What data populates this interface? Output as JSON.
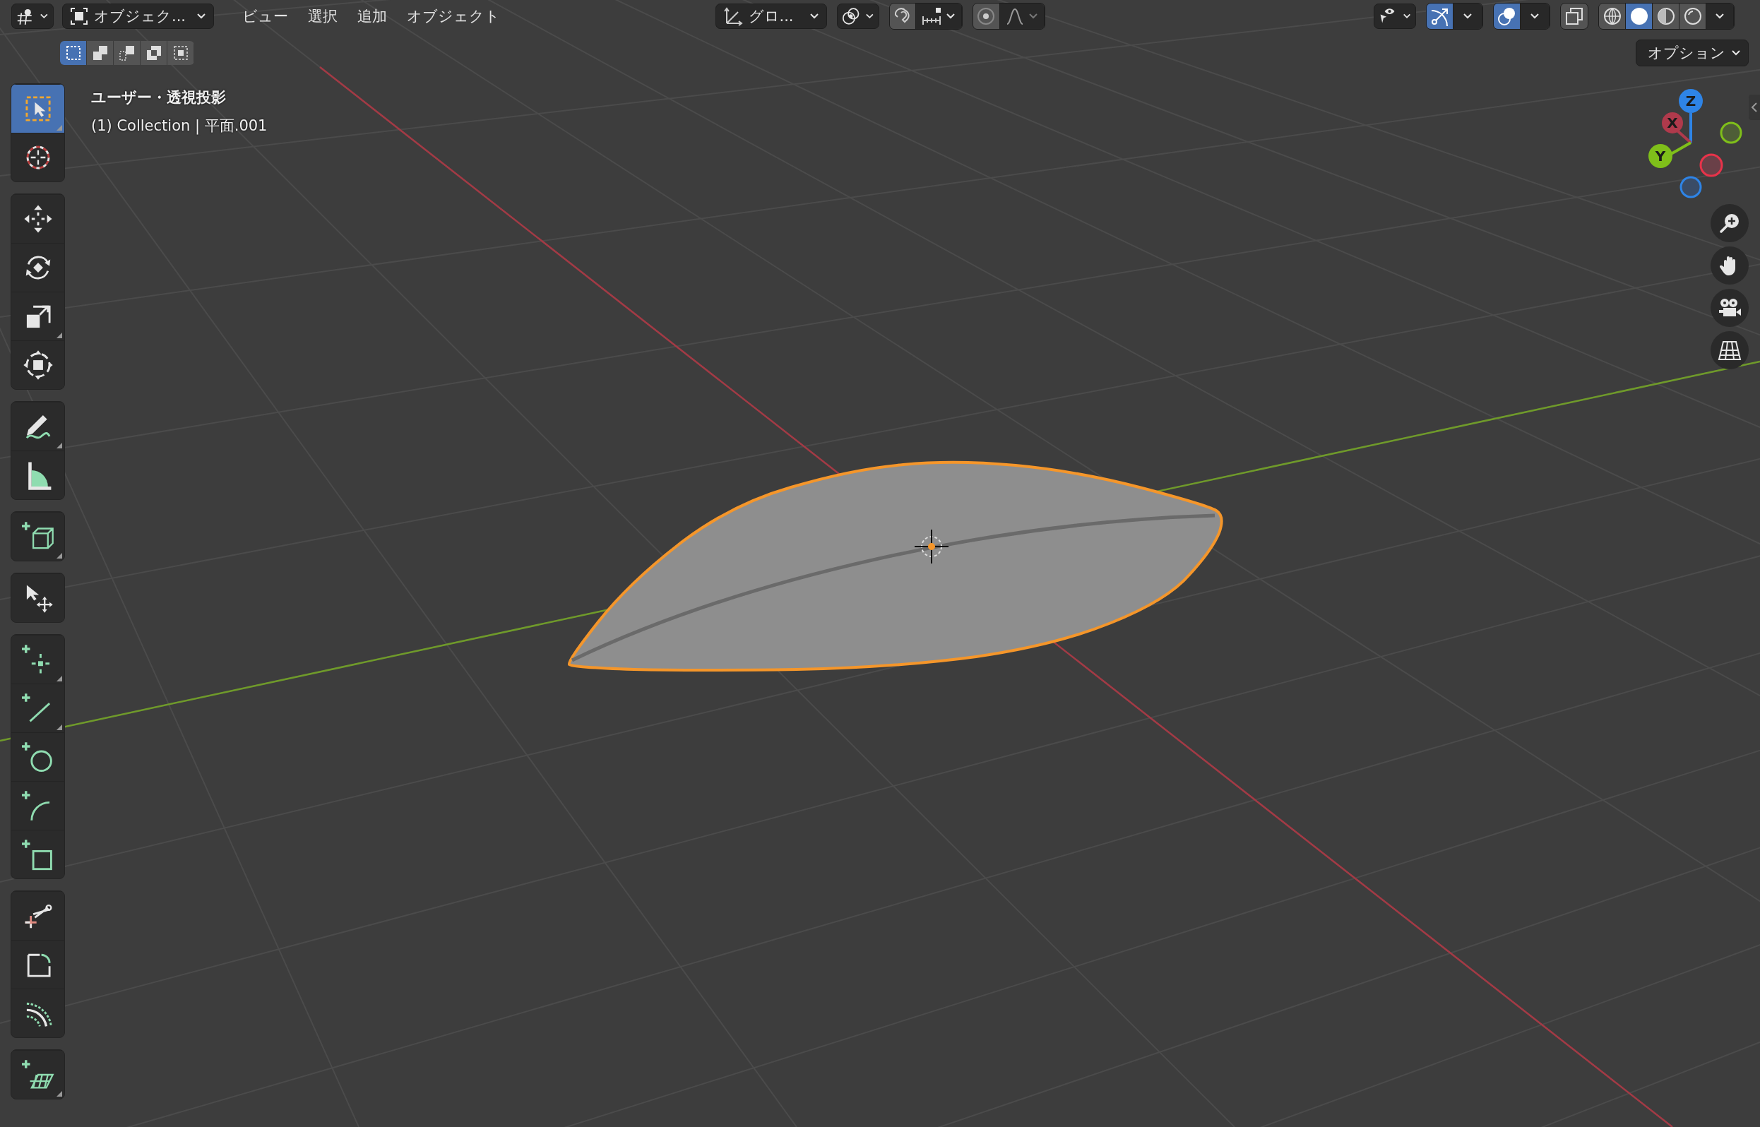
{
  "header": {
    "mode_dropdown": "オブジェク...",
    "menus": [
      "ビュー",
      "選択",
      "追加",
      "オブジェクト"
    ],
    "orientation_dropdown": "グロ...",
    "snap": {
      "on": false
    },
    "proportional_edit": {
      "on": false
    },
    "show_gizmo": {
      "on": true
    },
    "show_overlays": {
      "on": true
    },
    "xray": {
      "on": false
    },
    "shading_modes": [
      {
        "kind": "wireframe",
        "selected": false
      },
      {
        "kind": "solid",
        "selected": true
      },
      {
        "kind": "material",
        "selected": false
      },
      {
        "kind": "rendered",
        "selected": false
      }
    ],
    "options": "オプション"
  },
  "select_modes": [
    {
      "kind": "set",
      "selected": true
    },
    {
      "kind": "extend",
      "selected": false
    },
    {
      "kind": "subtract",
      "selected": false
    },
    {
      "kind": "invert",
      "selected": false
    },
    {
      "kind": "intersect",
      "selected": false
    }
  ],
  "viewport": {
    "view_name": "ユーザー・透視投影",
    "object_info": "(1) Collection | 平面.001"
  },
  "toolbar": [
    {
      "tools": [
        {
          "kind": "select_box",
          "selected": true,
          "flyout": true
        },
        {
          "kind": "cursor",
          "selected": false,
          "flyout": false
        }
      ]
    },
    {
      "tools": [
        {
          "kind": "move",
          "selected": false,
          "flyout": false
        },
        {
          "kind": "rotate",
          "selected": false,
          "flyout": false
        },
        {
          "kind": "scale",
          "selected": false,
          "flyout": true
        },
        {
          "kind": "transform",
          "selected": false,
          "flyout": false
        }
      ]
    },
    {
      "tools": [
        {
          "kind": "annotate",
          "selected": false,
          "flyout": true
        },
        {
          "kind": "measure",
          "selected": false,
          "flyout": false
        }
      ]
    },
    {
      "tools": [
        {
          "kind": "add_cube",
          "selected": false,
          "flyout": true
        }
      ]
    },
    {
      "tools": [
        {
          "kind": "pointer_move",
          "selected": false,
          "flyout": false
        }
      ]
    },
    {
      "tools": [
        {
          "kind": "add_point",
          "selected": false,
          "flyout": true
        },
        {
          "kind": "add_line",
          "selected": false,
          "flyout": true
        },
        {
          "kind": "add_circle",
          "selected": false,
          "flyout": false
        },
        {
          "kind": "add_arc",
          "selected": false,
          "flyout": false
        },
        {
          "kind": "add_rect",
          "selected": false,
          "flyout": false
        }
      ]
    },
    {
      "tools": [
        {
          "kind": "knife",
          "selected": false,
          "flyout": false
        },
        {
          "kind": "corner",
          "selected": false,
          "flyout": false
        },
        {
          "kind": "offset",
          "selected": false,
          "flyout": false
        }
      ]
    },
    {
      "tools": [
        {
          "kind": "add_grid",
          "selected": false,
          "flyout": true
        }
      ]
    }
  ],
  "gizmo": {
    "axes": [
      {
        "label": "Z"
      },
      {
        "label": "X"
      },
      {
        "label": "Y"
      }
    ]
  }
}
